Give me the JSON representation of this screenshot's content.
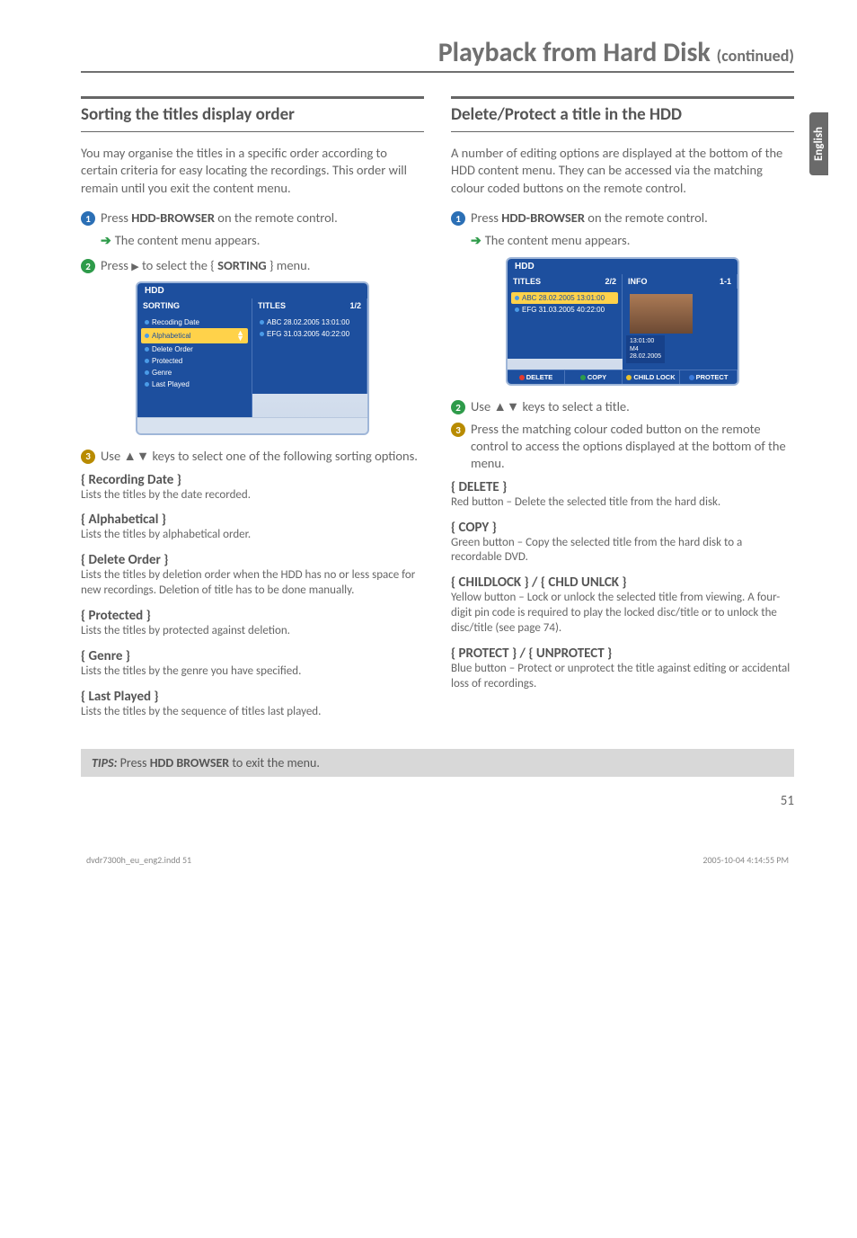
{
  "page": {
    "title_main": "Playback from Hard Disk ",
    "title_sub": "(continued)",
    "side_tab": "English",
    "page_number": "51"
  },
  "tips": {
    "label": "TIPS:",
    "text": "   Press ",
    "bold": "HDD BROWSER",
    "after": " to exit the menu."
  },
  "left": {
    "section_title": "Sorting the titles display order",
    "intro": "You may organise the titles in a specific order according to certain criteria for easy locating the recordings. This order will remain until you exit the content menu.",
    "step1a": "Press ",
    "step1b": "HDD-BROWSER",
    "step1c": " on the remote control.",
    "arrow1": "The content menu appears.",
    "step2a": "Press ",
    "step2b": " to select the { ",
    "step2c": "SORTING",
    "step2d": " } menu.",
    "step3": "Use ▲▼ keys to select one of the following sorting options.",
    "subs": [
      {
        "head": "{ Recording Date }",
        "desc": "Lists the titles by the date recorded."
      },
      {
        "head": "{ Alphabetical }",
        "desc": "Lists the titles by alphabetical order."
      },
      {
        "head": "{ Delete Order }",
        "desc": "Lists the titles by deletion order when the HDD has no or less space for new recordings. Deletion of title has to be done manually."
      },
      {
        "head": "{ Protected }",
        "desc": "Lists the titles by protected against deletion."
      },
      {
        "head": "{ Genre }",
        "desc": "Lists the titles by the genre you have specified."
      },
      {
        "head": "{ Last Played }",
        "desc": "Lists the titles by the sequence of titles last played."
      }
    ],
    "ui": {
      "hdd": "HDD",
      "col1": "SORTING",
      "col1n": "",
      "col2": "TITLES",
      "col2n": "1/2",
      "items": [
        {
          "label": "Recoding Date"
        },
        {
          "label": "Alphabetical",
          "sel": true
        },
        {
          "label": "Delete Order"
        },
        {
          "label": "Protected"
        },
        {
          "label": "Genre"
        },
        {
          "label": "Last Played"
        }
      ],
      "right_items": [
        "ABC 28.02.2005   13:01:00",
        "EFG 31.03.2005   40:22:00"
      ]
    }
  },
  "right": {
    "section_title": "Delete/Protect a title in the HDD",
    "intro": "A number of editing options are displayed at the bottom of the HDD content menu. They can be accessed via the matching colour coded buttons on the remote control.",
    "step1a": "Press ",
    "step1b": "HDD-BROWSER",
    "step1c": " on the remote control.",
    "arrow1": "The content menu appears.",
    "step2": "Use ▲▼ keys to select a title.",
    "step3": "Press the matching colour coded button on the remote control to access the options displayed at the bottom of the menu.",
    "subs": [
      {
        "head": "{ DELETE }",
        "desc": "Red button – Delete the selected title from the hard disk."
      },
      {
        "head": "{ COPY }",
        "desc": "Green button – Copy the selected title from the hard disk to a recordable DVD."
      },
      {
        "head": "{ CHILDLOCK } / { CHLD UNLCK }",
        "desc": "Yellow button – Lock or unlock the selected title from viewing.  A four-digit pin code is required to play the locked disc/title or to unlock the disc/title (see page 74)."
      },
      {
        "head": "{ PROTECT } / { UNPROTECT }",
        "desc": "Blue button – Protect or unprotect the title against editing or accidental loss of recordings."
      }
    ],
    "ui": {
      "hdd": "HDD",
      "col1": "TITLES",
      "col1n": "2/2",
      "col2": "INFO",
      "col2n": "1-1",
      "left_items": [
        {
          "label": "ABC 28.02.2005   13:01:00",
          "sel": true
        },
        {
          "label": "EFG 31.03.2005   40:22:00"
        }
      ],
      "info_lines": [
        "13:01:00",
        "M4",
        "28.02.2005"
      ],
      "buttons": [
        {
          "label": "DELETE",
          "color": "red"
        },
        {
          "label": "COPY",
          "color": "green"
        },
        {
          "label": "CHILD LOCK",
          "color": "yellow"
        },
        {
          "label": "PROTECT",
          "color": "blue"
        }
      ]
    }
  },
  "footer": {
    "left": "dvdr7300h_eu_eng2.indd   51",
    "right": "2005-10-04   4:14:55 PM"
  }
}
